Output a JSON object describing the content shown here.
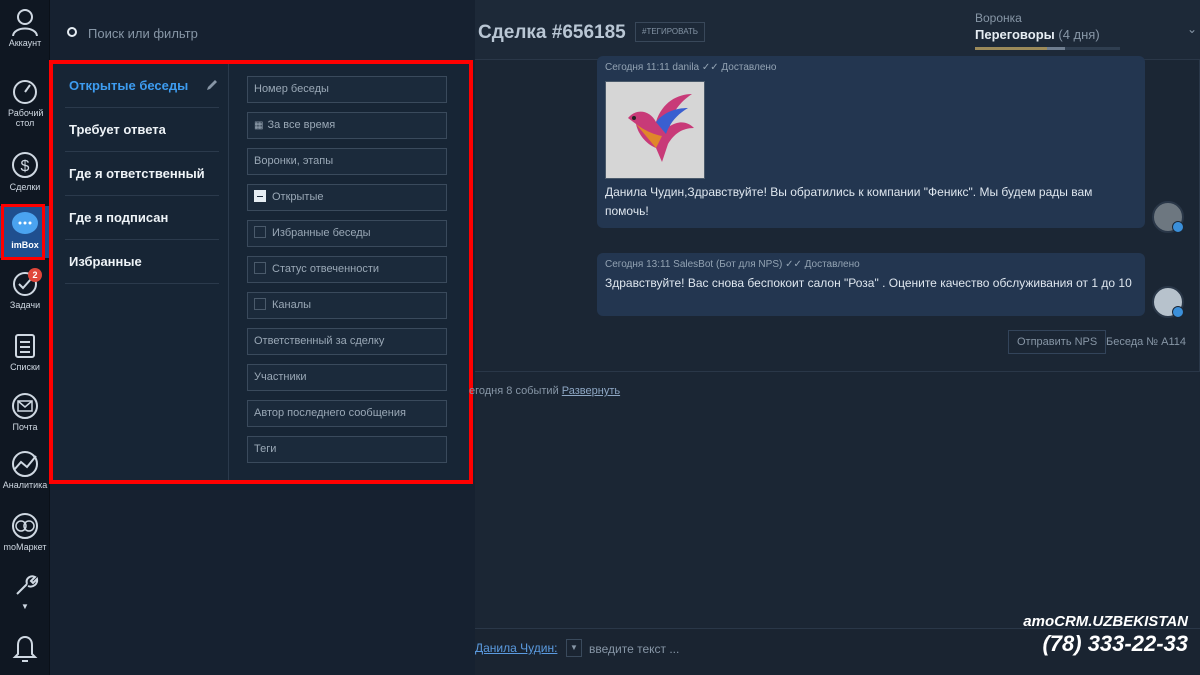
{
  "nav": {
    "items": [
      {
        "label": "Аккаунт"
      },
      {
        "label": "Рабочий стол"
      },
      {
        "label": "Сделки"
      },
      {
        "label": "imBox"
      },
      {
        "label": "Задачи",
        "badge": "2"
      },
      {
        "label": "Списки"
      },
      {
        "label": "Почта"
      },
      {
        "label": "Аналитика"
      },
      {
        "label": "moМаркет"
      }
    ]
  },
  "panel": {
    "search_placeholder": "Поиск или фильтр",
    "presets": [
      {
        "label": "Открытые беседы"
      },
      {
        "label": "Требует ответа"
      },
      {
        "label": "Где я ответственный"
      },
      {
        "label": "Где я подписан"
      },
      {
        "label": "Избранные"
      }
    ],
    "fields": [
      {
        "label": "Номер беседы"
      },
      {
        "label": "За все время"
      },
      {
        "label": "Воронки, этапы"
      },
      {
        "label": "Открытые"
      },
      {
        "label": "Избранные беседы"
      },
      {
        "label": "Статус отвеченности"
      },
      {
        "label": "Каналы"
      },
      {
        "label": "Ответственный за сделку"
      },
      {
        "label": "Участники"
      },
      {
        "label": "Автор последнего сообщения"
      },
      {
        "label": "Теги"
      }
    ]
  },
  "deal": {
    "title": "Сделка #656185",
    "tag_button": "#ТЕГИРОВАТЬ",
    "funnel_label": "Воронка",
    "funnel_stage": "Переговоры",
    "funnel_days": "(4 дня)",
    "progress_pct": 62
  },
  "messages": [
    {
      "meta": "Сегодня 11:11 danila ✓✓ Доставлено",
      "text": "Данила Чудин,Здравствуйте! Вы обратились к компании \"Феникс\". Мы будем рады вам помочь!"
    },
    {
      "meta": "Сегодня 13:11 SalesBot (Бот для NPS) ✓✓ Доставлено",
      "text": "Здравствуйте! Вас снова беспокоит салон \"Роза\" . Оцените качество обслуживания от 1 до 10"
    }
  ],
  "feed": {
    "nps_button": "Отправить NPS",
    "conversation_no": "Беседа № А114",
    "events_text": "егодня 8 событий",
    "events_link": "Развернуть"
  },
  "composer": {
    "name": "Данила Чудин:",
    "placeholder": "введите текст ..."
  },
  "brand": {
    "name": "amoCRM.UZBEKISTAN",
    "phone": "(78) 333-22-33"
  },
  "colors": {
    "highlight": "#ff0000",
    "accent": "#3d9cf0",
    "active_nav": "#1f4f8f"
  }
}
